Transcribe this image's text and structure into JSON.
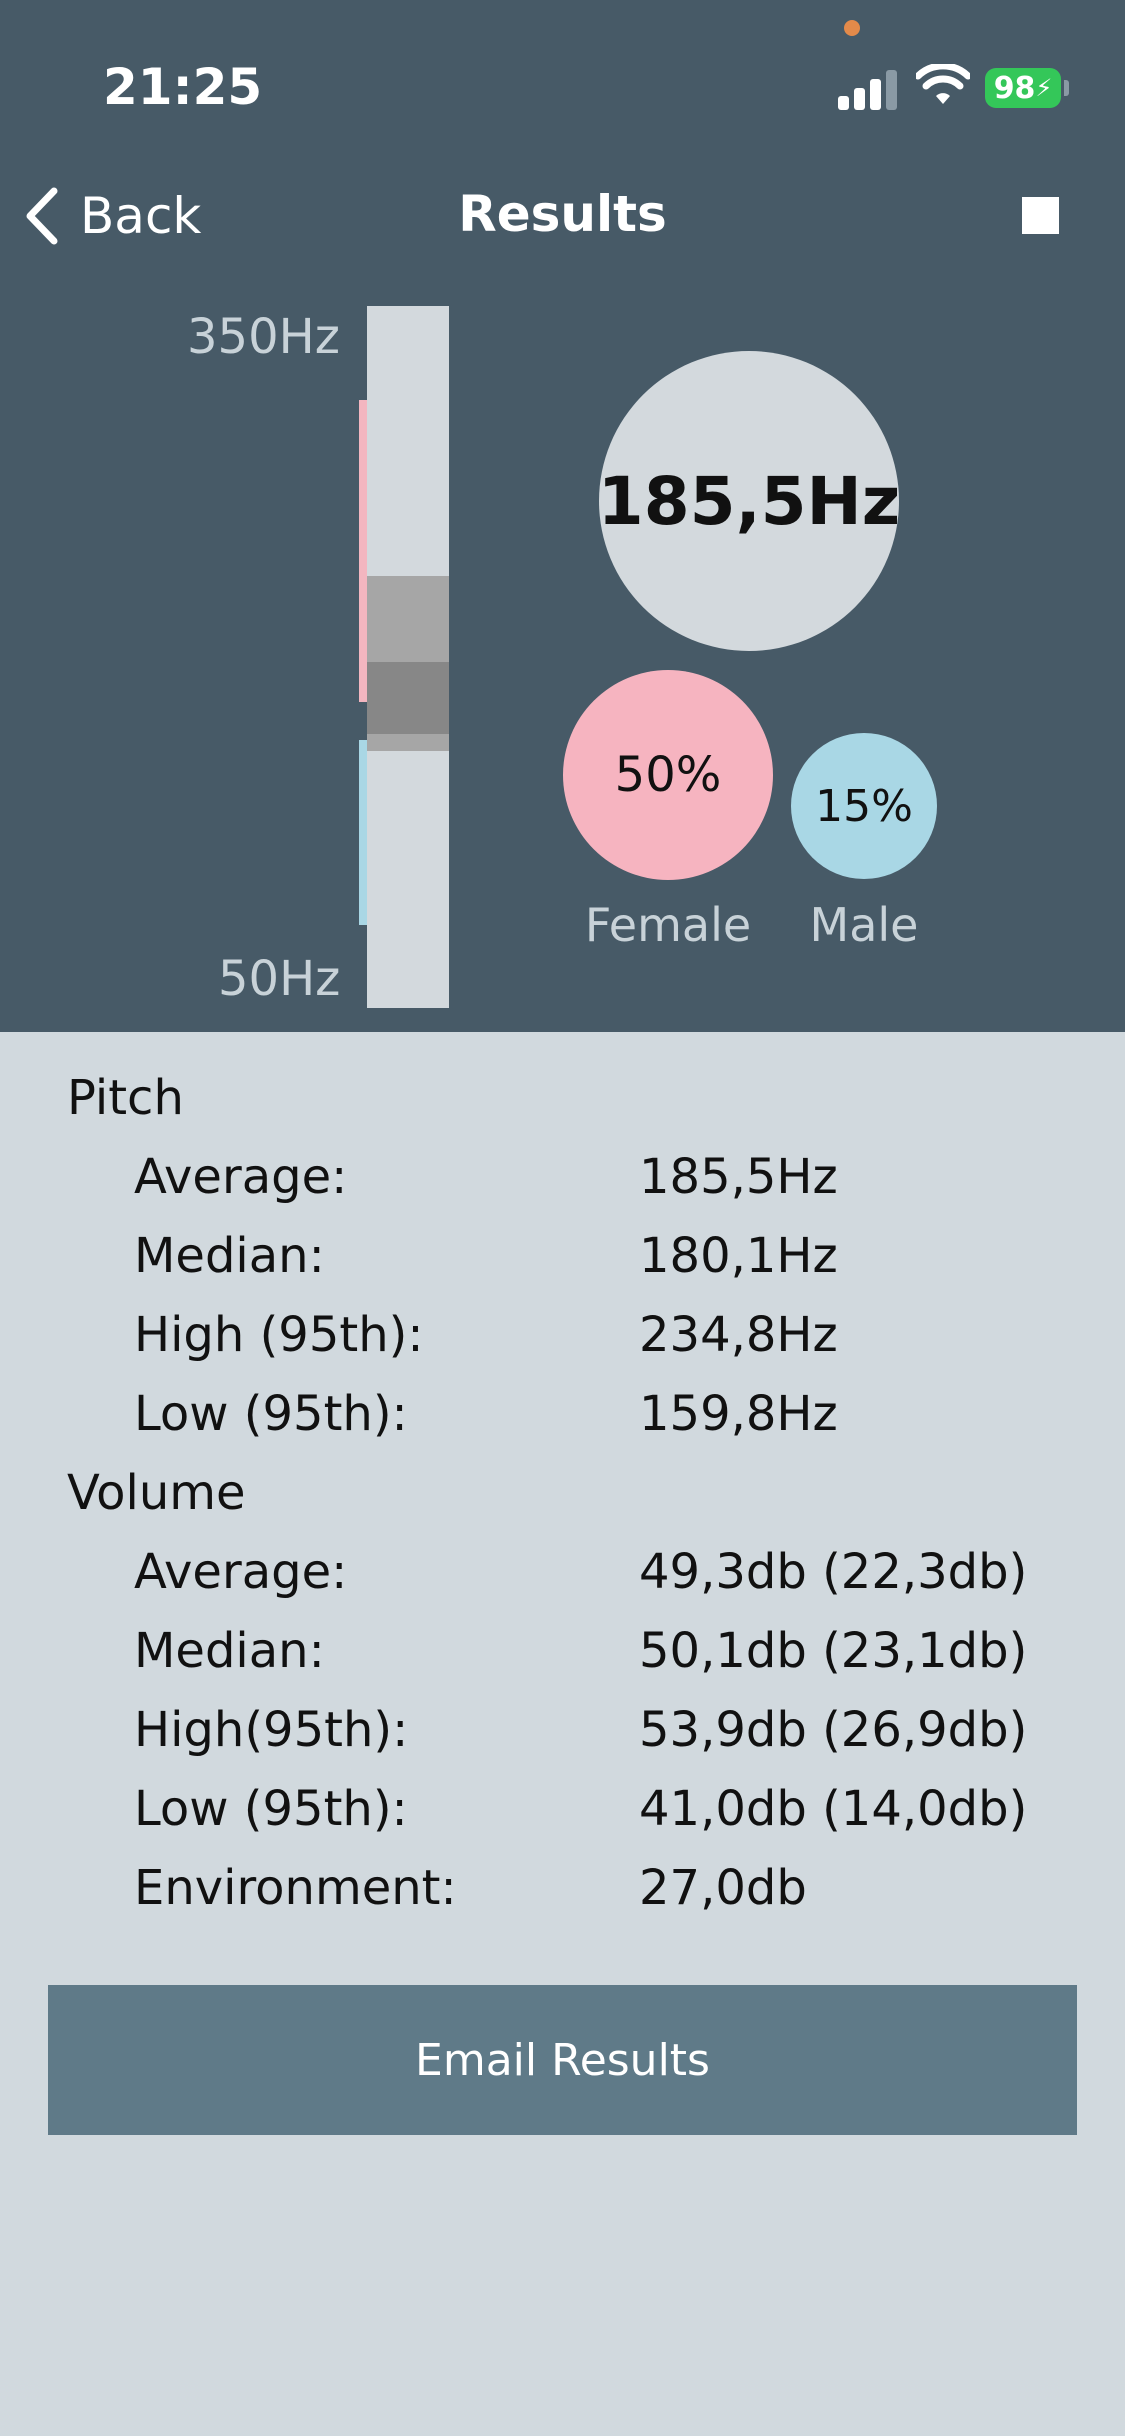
{
  "status_bar": {
    "time": "21:25",
    "battery": "98"
  },
  "nav": {
    "back_label": "Back",
    "title": "Results"
  },
  "pitch_bar": {
    "max_label": "350Hz",
    "min_label": "50Hz",
    "min_hz": 50,
    "max_hz": 350
  },
  "summary": {
    "average_pitch": "185,5Hz",
    "female_percent": "50%",
    "female_label": "Female",
    "male_percent": "15%",
    "male_label": "Male"
  },
  "pitch": {
    "title": "Pitch",
    "rows": [
      {
        "label": "Average:",
        "value": "185,5Hz"
      },
      {
        "label": "Median:",
        "value": "180,1Hz"
      },
      {
        "label": "High (95th):",
        "value": "234,8Hz"
      },
      {
        "label": "Low (95th):",
        "value": "159,8Hz"
      }
    ]
  },
  "volume": {
    "title": "Volume",
    "rows": [
      {
        "label": "Average:",
        "value": "49,3db (22,3db)"
      },
      {
        "label": "Median:",
        "value": "50,1db (23,1db)"
      },
      {
        "label": "High(95th):",
        "value": "53,9db (26,9db)"
      },
      {
        "label": "Low (95th):",
        "value": "41,0db (14,0db)"
      },
      {
        "label": "Environment:",
        "value": "27,0db"
      }
    ]
  },
  "email_button_label": "Email Results",
  "colors": {
    "header_bg": "#475a67",
    "body_bg": "#d1d9de",
    "female": "#f6b4c0",
    "male": "#a9d7e5",
    "button": "#5f7a88"
  }
}
